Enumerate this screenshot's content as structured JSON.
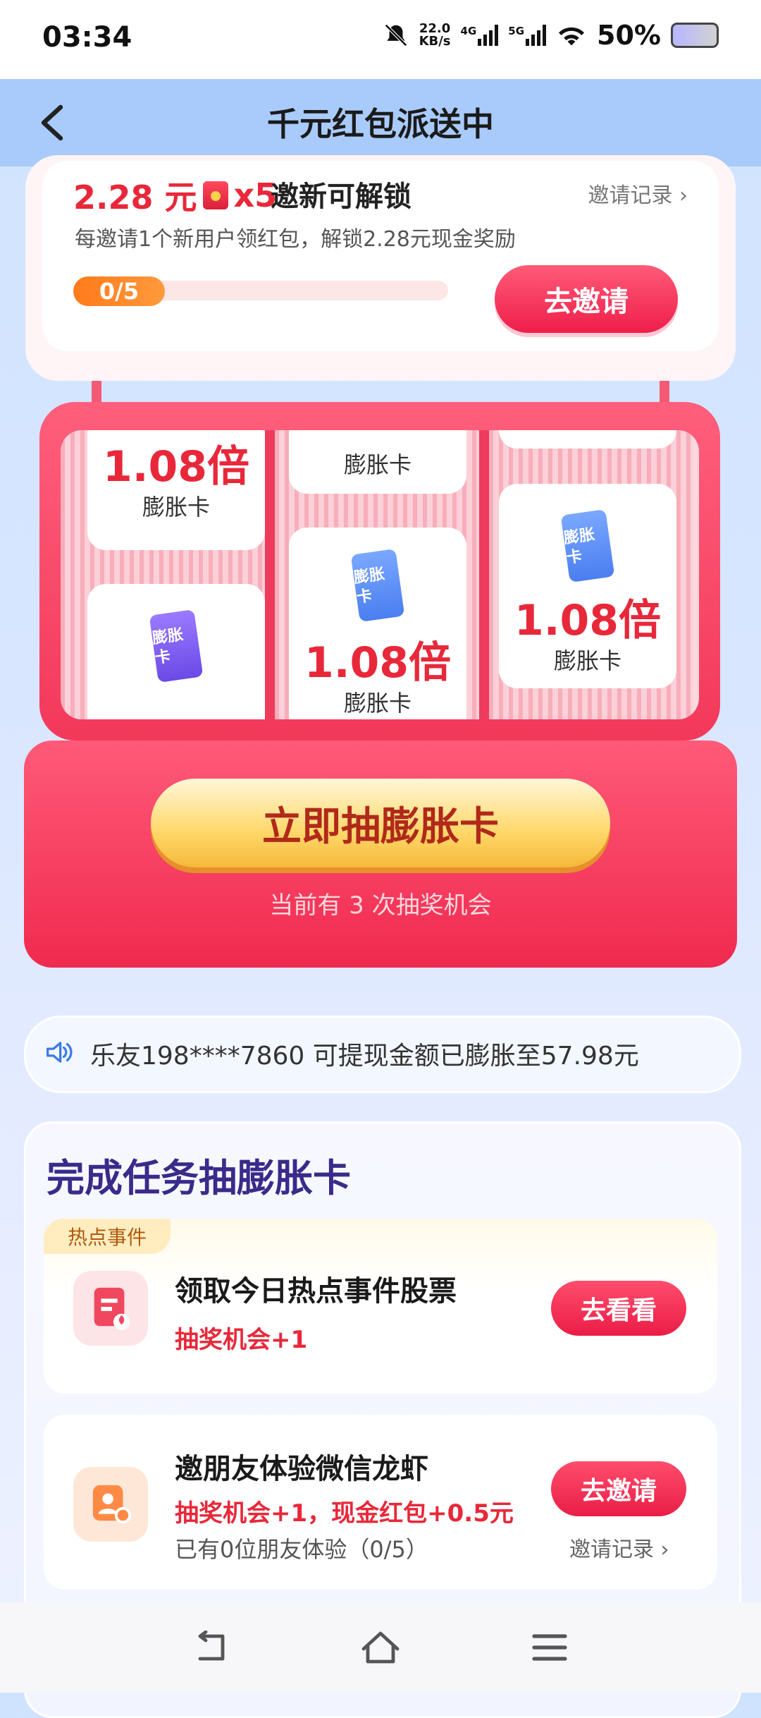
{
  "status": {
    "time": "03:34",
    "net_speed_top": "22.0",
    "net_speed_unit": "KB/s",
    "sig1": "4G",
    "sig2": "5G",
    "battery": "50%"
  },
  "header": {
    "title": "千元红包派送中"
  },
  "invite": {
    "amount_prefix": "2.28 元",
    "amount_suffix": "x5",
    "unlock_label": "邀新可解锁",
    "record_label": "邀请记录",
    "description": "每邀请1个新用户领红包，解锁2.28元现金奖励",
    "progress_text": "0/5",
    "progress_value": 0,
    "progress_total": 5,
    "button_label": "去邀请"
  },
  "machine": {
    "col1": [
      {
        "multiplier": "1.08倍",
        "label": "膨胀卡"
      },
      {
        "icon_text": "膨胀卡"
      }
    ],
    "col2": [
      {
        "label": "膨胀卡"
      },
      {
        "icon_text": "膨胀卡"
      },
      {
        "multiplier": "1.08倍",
        "label": "膨胀卡"
      }
    ],
    "col3": [
      {
        "icon_text": "膨胀卡"
      },
      {
        "multiplier": "1.08倍",
        "label": "膨胀卡"
      }
    ],
    "draw_button": "立即抽膨胀卡",
    "chances": "当前有 3 次抽奖机会"
  },
  "ticker": {
    "text": "乐友198****7860 可提现金额已膨胀至57.98元"
  },
  "tasks": {
    "title": "完成任务抽膨胀卡",
    "items": [
      {
        "tag": "热点事件",
        "name": "领取今日热点事件股票",
        "reward": "抽奖机会+1",
        "button": "去看看"
      },
      {
        "name": "邀朋友体验微信龙虾",
        "reward": "抽奖机会+1，现金红包+0.5元",
        "note": "已有0位朋友体验（0/5）",
        "button": "去邀请",
        "record": "邀请记录"
      }
    ]
  },
  "colors": {
    "accent": "#e8283a",
    "header_bg": "#a9cbfb",
    "title_purple": "#3a2a8a"
  }
}
